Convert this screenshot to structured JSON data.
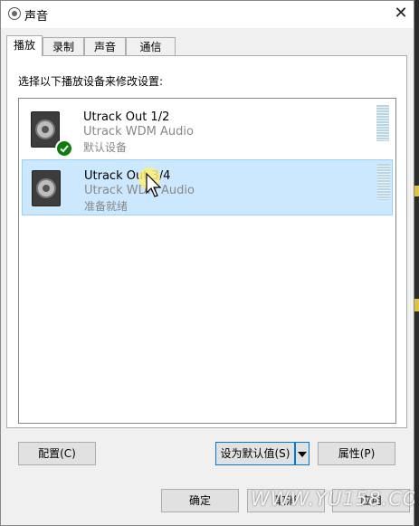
{
  "window": {
    "title": "声音"
  },
  "tabs": [
    {
      "label": "播放"
    },
    {
      "label": "录制"
    },
    {
      "label": "声音"
    },
    {
      "label": "通信"
    }
  ],
  "panel": {
    "instruction": "选择以下播放设备来修改设置:"
  },
  "devices": [
    {
      "name": "Utrack Out 1/2",
      "driver": "Utrack WDM Audio",
      "status": "默认设备",
      "is_default": true,
      "selected": false
    },
    {
      "name": "Utrack Out 3/4",
      "driver": "Utrack WDM Audio",
      "status": "准备就绪",
      "is_default": false,
      "selected": true
    }
  ],
  "panel_buttons": {
    "configure": "配置(C)",
    "set_default": "设为默认值(S)",
    "properties": "属性(P)"
  },
  "dialog_buttons": {
    "ok": "确定",
    "cancel": "取消",
    "apply": "应用"
  },
  "watermark": "WWW.YU158.COM",
  "colors": {
    "selection_bg": "#cce8ff",
    "selection_border": "#99d1ff",
    "default_badge": "#107c10",
    "focus_border": "#0078d7"
  }
}
